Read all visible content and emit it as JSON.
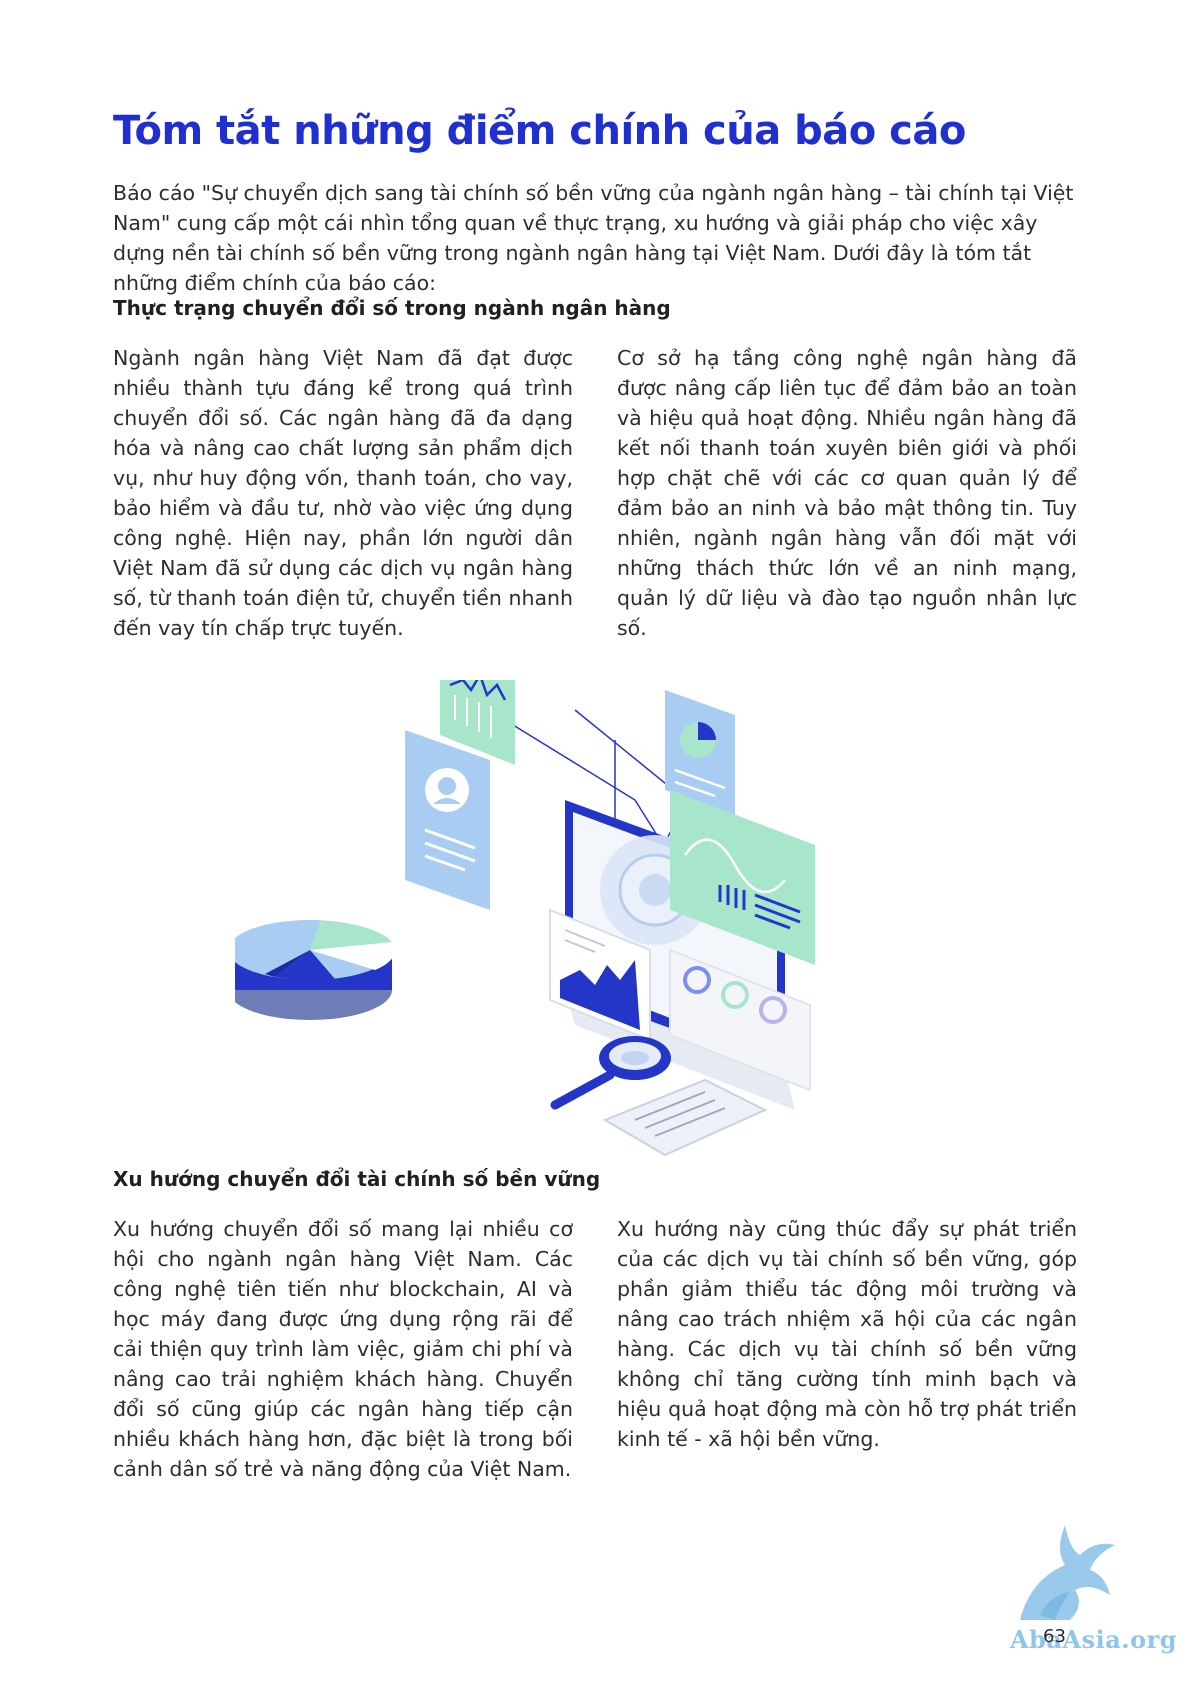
{
  "title": "Tóm tắt những điểm chính của báo cáo",
  "intro": "Báo cáo \"Sự chuyển dịch sang tài chính số bền vững của ngành ngân hàng – tài chính tại Việt Nam\" cung cấp một cái nhìn tổng quan về thực trạng, xu hướng và giải pháp cho việc xây dựng nền tài chính số bền vững trong ngành ngân hàng tại Việt Nam. Dưới đây là tóm tắt những điểm chính của báo cáo:",
  "section1": {
    "heading": "Thực trạng chuyển đổi số trong ngành ngân hàng",
    "col1": "Ngành ngân hàng Việt Nam đã đạt được nhiều thành tựu đáng kể trong quá trình chuyển đổi số. Các ngân hàng đã đa dạng hóa và nâng cao chất lượng sản phẩm dịch vụ, như huy động vốn, thanh toán, cho vay, bảo hiểm và đầu tư, nhờ vào việc ứng dụng công nghệ. Hiện nay, phần lớn người dân Việt Nam đã sử dụng các dịch vụ ngân hàng số, từ thanh toán điện tử, chuyển tiền nhanh đến vay tín chấp trực tuyến.",
    "col2": "Cơ sở hạ tầng công nghệ ngân hàng đã được nâng cấp liên tục để đảm bảo an toàn và hiệu quả hoạt động. Nhiều ngân hàng đã kết nối thanh toán xuyên biên giới và phối hợp chặt chẽ với các cơ quan quản lý để đảm bảo an ninh và bảo mật thông tin. Tuy nhiên, ngành ngân hàng vẫn đối mặt với những thách thức lớn về an ninh mạng, quản lý dữ liệu và đào tạo nguồn nhân lực số."
  },
  "section2": {
    "heading": "Xu hướng chuyển đổi tài chính số bền vững",
    "col1": "Xu hướng chuyển đổi số mang lại nhiều cơ hội cho ngành ngân hàng Việt Nam. Các công nghệ tiên tiến như blockchain, AI và học máy đang được ứng dụng rộng rãi để cải thiện quy trình làm việc, giảm chi phí và nâng cao trải nghiệm khách hàng. Chuyển đổi số cũng giúp các ngân hàng tiếp cận nhiều khách hàng hơn, đặc biệt là trong bối cảnh dân số trẻ và năng động của Việt Nam.",
    "col2": "Xu hướng này cũng thúc đẩy sự phát triển của các dịch vụ tài chính số bền vững, góp phần giảm thiểu tác động môi trường và nâng cao trách nhiệm xã hội của các ngân hàng. Các dịch vụ tài chính số bền vững không chỉ tăng cường tính minh bạch và hiệu quả hoạt động mà còn hỗ trợ phát triển kinh tế - xã hội bền vững."
  },
  "watermark": "AbaAsia.org",
  "page_number": "63",
  "colors": {
    "title": "#1f2fd0",
    "accent_blue": "#2436c8",
    "light_blue": "#9cc8f0",
    "mint": "#a8e6cc"
  }
}
